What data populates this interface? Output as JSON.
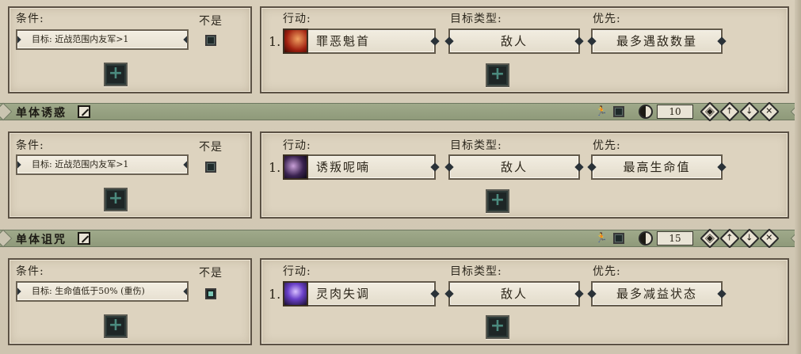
{
  "labels": {
    "conditions": "条件:",
    "not": "不是",
    "action": "行动:",
    "target_type": "目标类型:",
    "priority": "优先:"
  },
  "rules": [
    {
      "condition": "目标: 近战范围内友军>1",
      "not_checked": false,
      "index": "1.",
      "ability": "罪恶魁首",
      "ability_icon": "demon-horns-icon",
      "target": "敌人",
      "priority": "最多遇敌数量"
    },
    {
      "condition": "目标: 近战范围内友军>1",
      "not_checked": false,
      "index": "1.",
      "ability": "诱叛呢喃",
      "ability_icon": "whisper-face-icon",
      "target": "敌人",
      "priority": "最高生命值"
    },
    {
      "condition": "目标: 生命值低于50% (重伤)",
      "not_checked": true,
      "index": "1.",
      "ability": "灵肉失调",
      "ability_icon": "curse-spirit-icon",
      "target": "敌人",
      "priority": "最多减益状态"
    }
  ],
  "sections": [
    {
      "title": "单体诱惑",
      "cooldown": "10"
    },
    {
      "title": "单体诅咒",
      "cooldown": "15"
    }
  ],
  "colors": {
    "bar_green": "#9fa98a",
    "panel_bg": "#ddd3bf",
    "add_button_plus": "#4b8a7e"
  }
}
